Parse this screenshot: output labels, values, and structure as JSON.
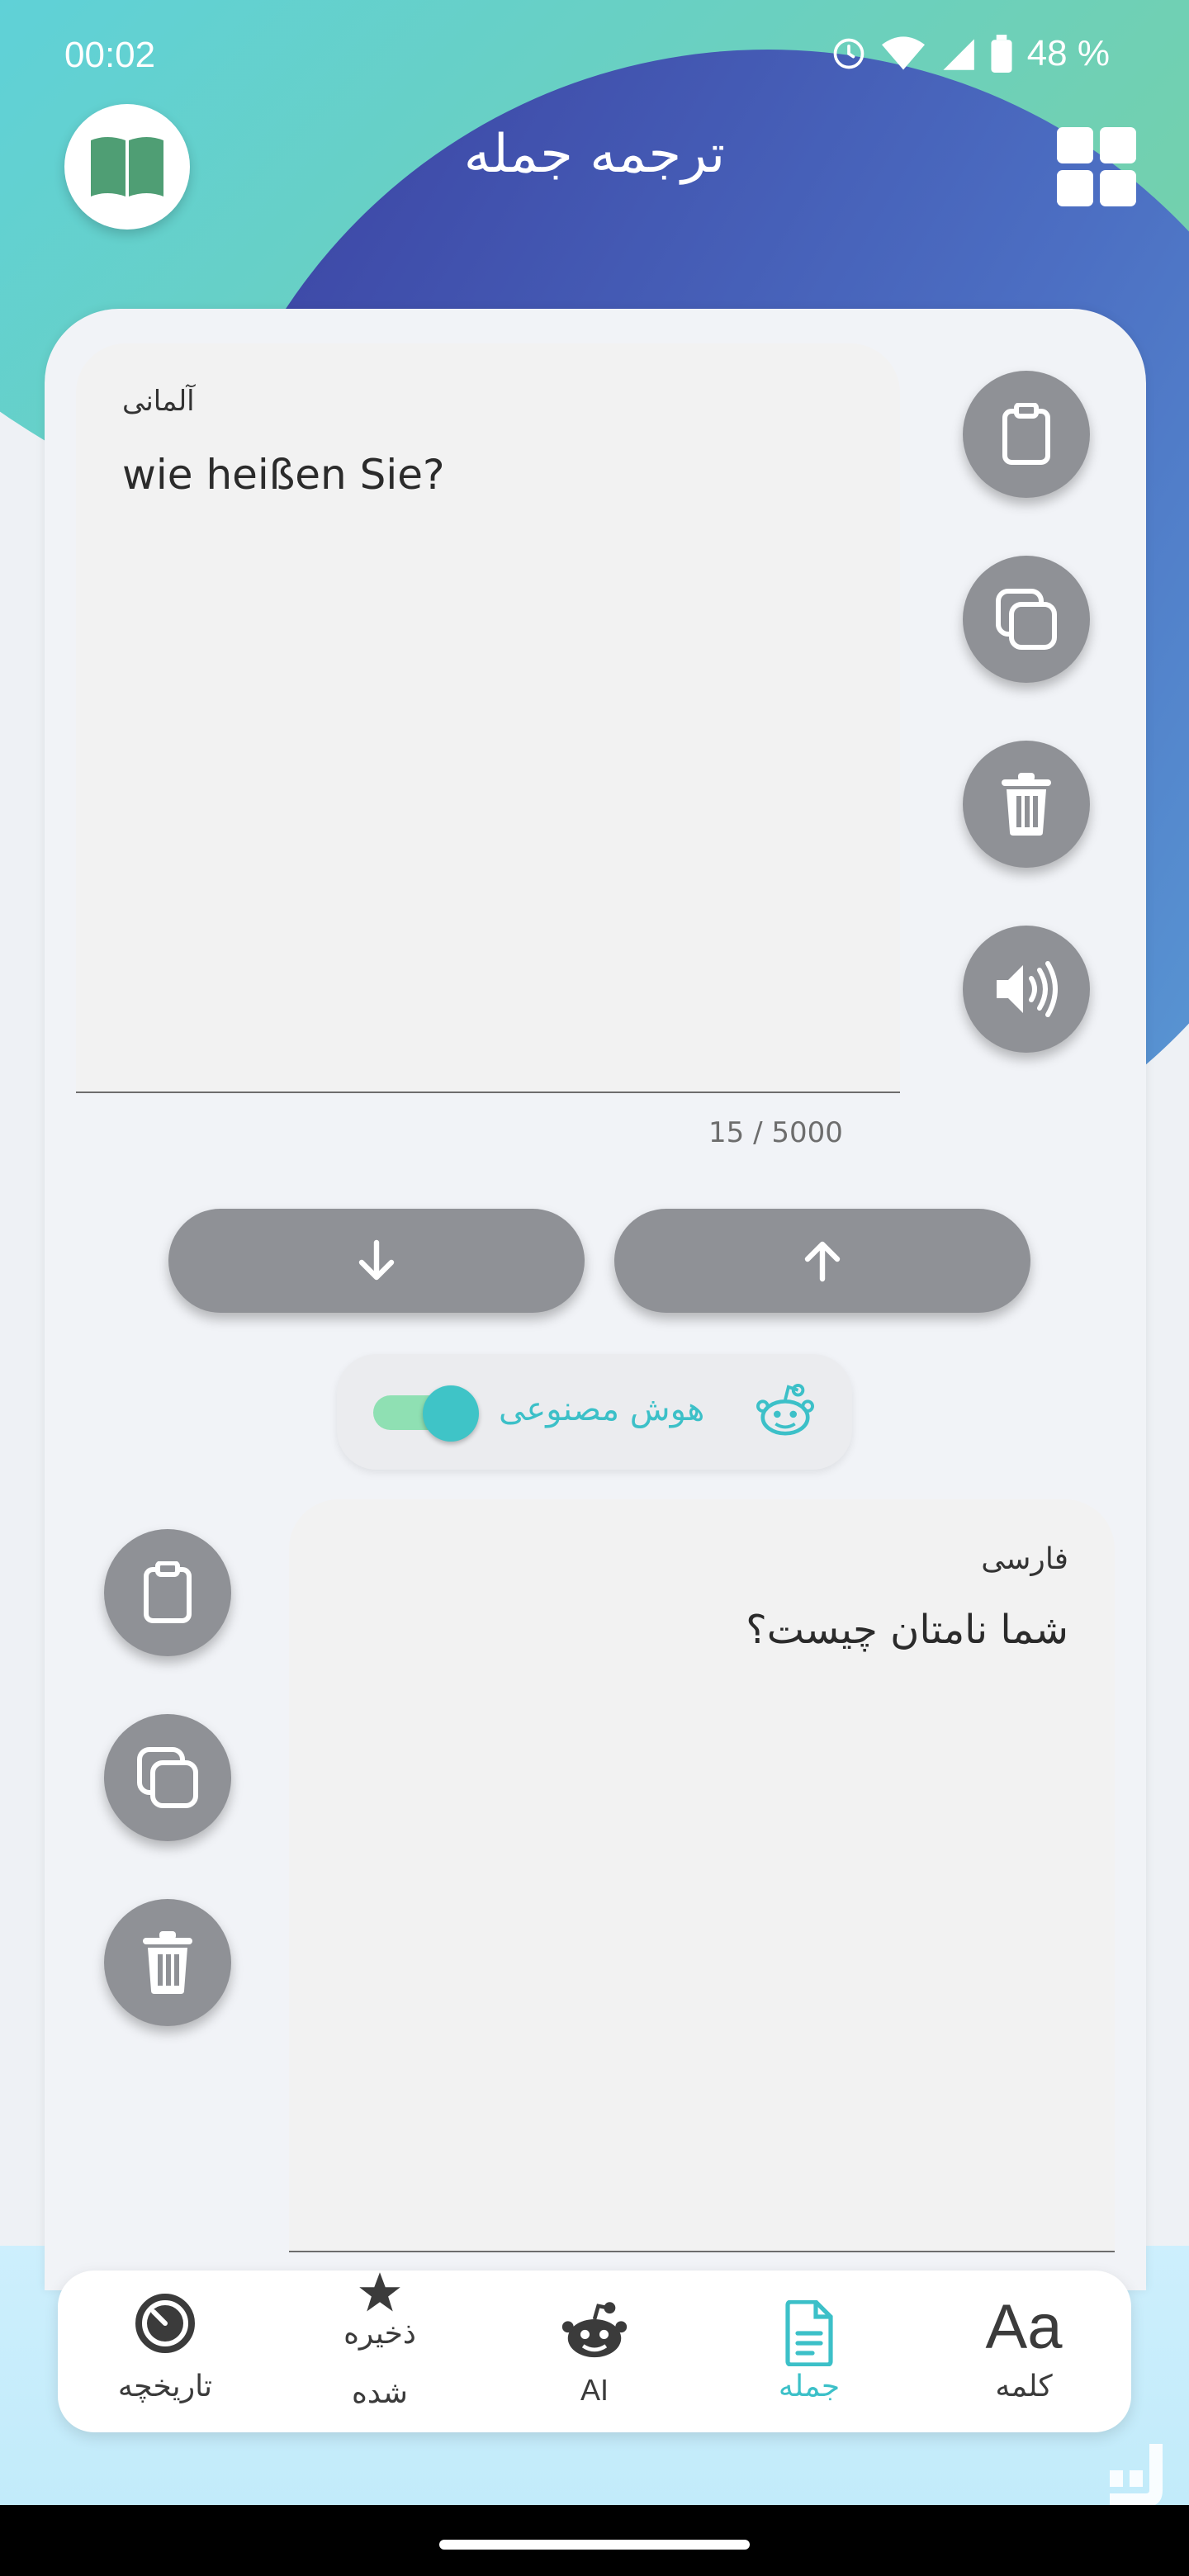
{
  "status": {
    "time": "00:02",
    "battery": "48 %"
  },
  "header": {
    "title": "ترجمه جمله"
  },
  "source": {
    "language": "آلمانی",
    "text": "wie heißen Sie?",
    "counter": "15 / 5000"
  },
  "ai_toggle": {
    "label": "هوش مصنوعی",
    "enabled": true
  },
  "target": {
    "language": "فارسی",
    "text": "شما نامتان چیست؟"
  },
  "nav": {
    "items": [
      {
        "label": "کلمه",
        "icon": "aa-icon",
        "active": false
      },
      {
        "label": "جمله",
        "icon": "document-icon",
        "active": true
      },
      {
        "label": "AI",
        "icon": "robot-icon",
        "active": false
      },
      {
        "label": "ذخیره",
        "label2": "شده",
        "icon": "star-icon",
        "active": false
      },
      {
        "label": "تاریخچه",
        "icon": "history-icon",
        "active": false
      }
    ]
  },
  "colors": {
    "accent": "#3cc0c8",
    "button_gray": "#8f9196",
    "book_green": "#4f9e74"
  }
}
